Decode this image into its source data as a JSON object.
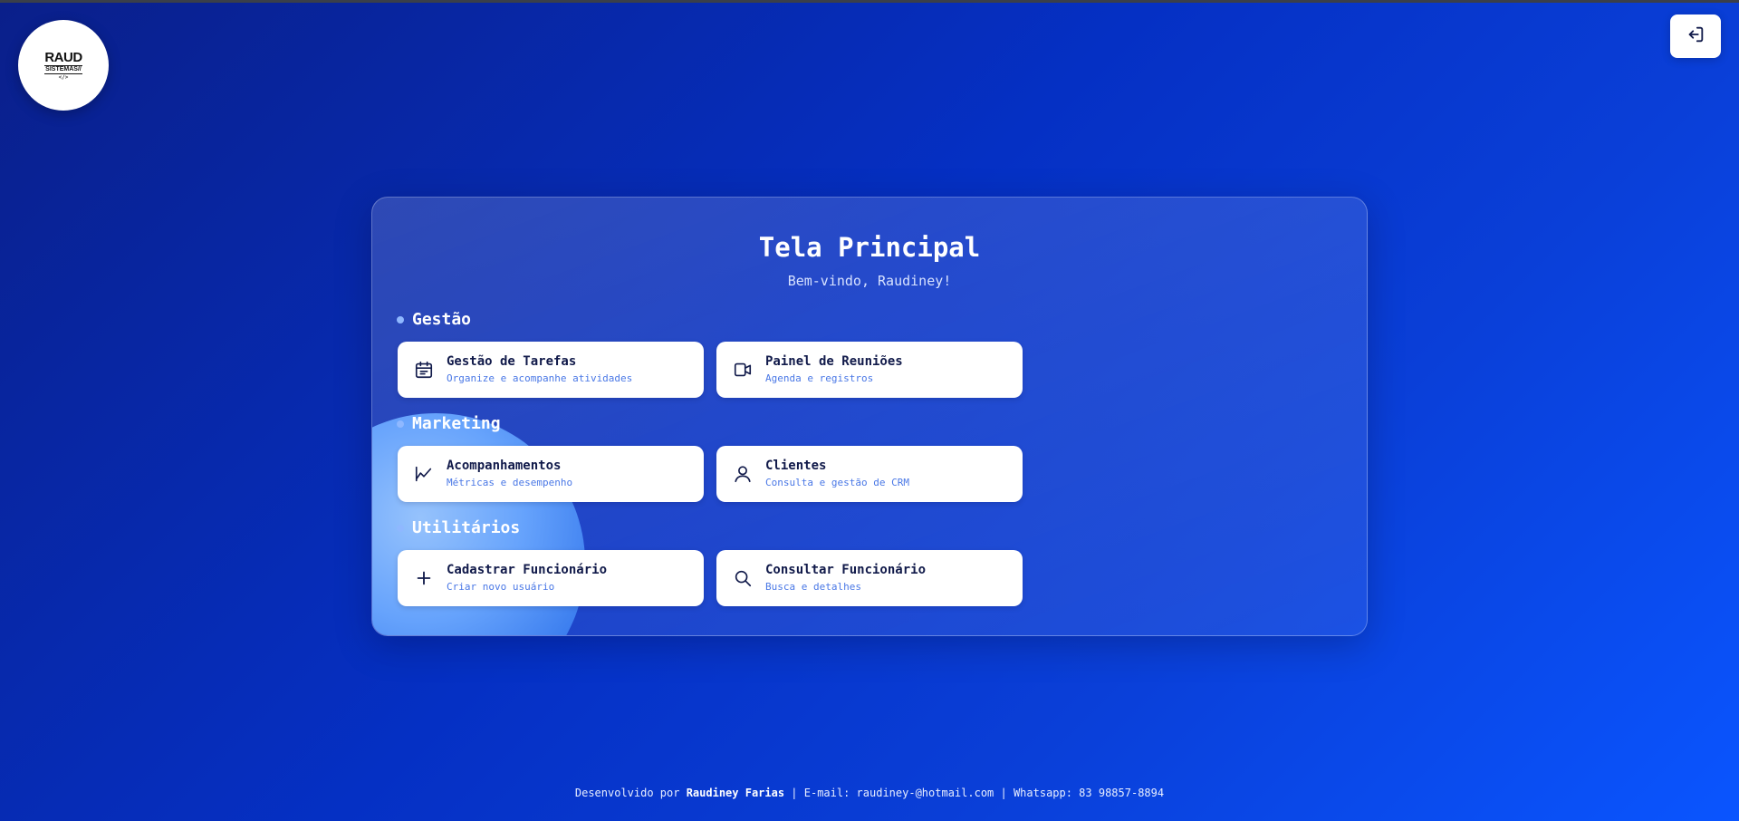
{
  "logo": {
    "line1": "RAUD",
    "line2": "SISTEMAS//",
    "line3": "</>"
  },
  "header": {
    "logout_icon": "logout-icon"
  },
  "main": {
    "title": "Tela Principal",
    "subtitle": "Bem-vindo, Raudiney!",
    "sections": [
      {
        "heading": "Gestão",
        "items": [
          {
            "title": "Gestão de Tarefas",
            "desc": "Organize e acompanhe atividades",
            "icon": "calendar-icon"
          },
          {
            "title": "Painel de Reuniões",
            "desc": "Agenda e registros",
            "icon": "video-icon"
          }
        ]
      },
      {
        "heading": "Marketing",
        "items": [
          {
            "title": "Acompanhamentos",
            "desc": "Métricas e desempenho",
            "icon": "chart-line-icon"
          },
          {
            "title": "Clientes",
            "desc": "Consulta e gestão de CRM",
            "icon": "user-icon"
          }
        ]
      },
      {
        "heading": "Utilitários",
        "items": [
          {
            "title": "Cadastrar Funcionário",
            "desc": "Criar novo usuário",
            "icon": "plus-icon"
          },
          {
            "title": "Consultar Funcionário",
            "desc": "Busca e detalhes",
            "icon": "search-icon"
          }
        ]
      }
    ]
  },
  "footer": {
    "prefix": "Desenvolvido por ",
    "author": "Raudiney Farias",
    "rest": " | E-mail: raudiney-@hotmail.com | Whatsapp: 83 98857-8894"
  },
  "colors": {
    "background_start": "#0a1f8a",
    "background_end": "#0a55ff",
    "tile_title": "#111a4a",
    "tile_desc": "#4a78e6"
  }
}
